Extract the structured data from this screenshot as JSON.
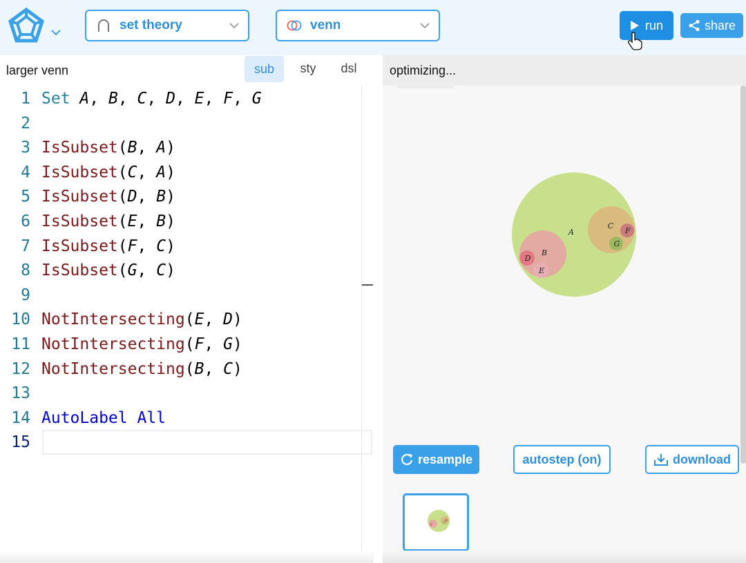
{
  "header": {
    "domain_dropdown": {
      "label": "set theory",
      "icon": "intersection-icon"
    },
    "style_dropdown": {
      "label": "venn",
      "icon": "venn-icon"
    },
    "run_label": "run",
    "share_label": "share",
    "colors": {
      "accent": "#3aa0e8",
      "run": "#1e8fe2",
      "header_bg": "#eef6fd"
    }
  },
  "editor": {
    "title": "larger venn",
    "tabs": [
      {
        "label": "sub",
        "active": true
      },
      {
        "label": "sty",
        "active": false
      },
      {
        "label": "dsl",
        "active": false
      }
    ],
    "lines": [
      {
        "n": "1",
        "text": "Set A, B, C, D, E, F, G"
      },
      {
        "n": "2",
        "text": ""
      },
      {
        "n": "3",
        "text": "IsSubset(B, A)"
      },
      {
        "n": "4",
        "text": "IsSubset(C, A)"
      },
      {
        "n": "5",
        "text": "IsSubset(D, B)"
      },
      {
        "n": "6",
        "text": "IsSubset(E, B)"
      },
      {
        "n": "7",
        "text": "IsSubset(F, C)"
      },
      {
        "n": "8",
        "text": "IsSubset(G, C)"
      },
      {
        "n": "9",
        "text": ""
      },
      {
        "n": "10",
        "text": "NotIntersecting(E, D)"
      },
      {
        "n": "11",
        "text": "NotIntersecting(F, G)"
      },
      {
        "n": "12",
        "text": "NotIntersecting(B, C)"
      },
      {
        "n": "13",
        "text": ""
      },
      {
        "n": "14",
        "text": "AutoLabel All"
      },
      {
        "n": "15",
        "text": ""
      }
    ],
    "active_line": "15"
  },
  "preview": {
    "status": "optimizing...",
    "sets": [
      {
        "label": "A",
        "color": "#c8e08c"
      },
      {
        "label": "B",
        "color": "#e8a0a4"
      },
      {
        "label": "C",
        "color": "#dcb47c"
      },
      {
        "label": "D",
        "color": "#e0707c"
      },
      {
        "label": "E",
        "color": "#e8b0b8"
      },
      {
        "label": "F",
        "color": "#c8707c"
      },
      {
        "label": "G",
        "color": "#90b85c"
      }
    ],
    "resample_label": "resample",
    "autostep_label": "autostep (on)",
    "download_label": "download"
  }
}
